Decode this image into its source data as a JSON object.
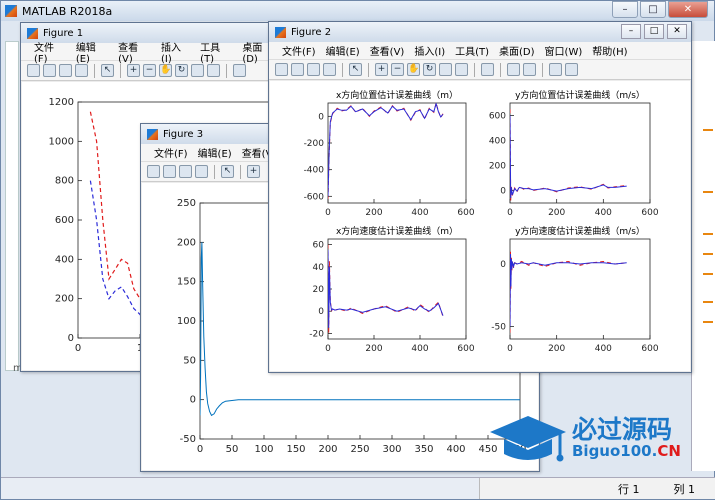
{
  "main_window": {
    "title": "MATLAB R2018a"
  },
  "status": {
    "row_label": "行",
    "row_value": "1",
    "col_label": "列",
    "col_value": "1"
  },
  "left_pane_letter": "m",
  "figure1": {
    "title": "Figure 1",
    "menu": [
      "文件(F)",
      "编辑(E)",
      "查看(V)",
      "插入(I)",
      "工具(T)",
      "桌面(D)"
    ]
  },
  "figure2": {
    "title": "Figure 2",
    "menu": [
      "文件(F)",
      "编辑(E)",
      "查看(V)",
      "插入(I)",
      "工具(T)",
      "桌面(D)",
      "窗口(W)",
      "帮助(H)"
    ]
  },
  "figure3": {
    "title": "Figure 3",
    "menu": [
      "文件(F)",
      "编辑(E)",
      "查看(V)"
    ]
  },
  "watermark": {
    "text_cn": "必过源码",
    "text_en_main": "Biguo100.",
    "text_en_accent": "CN"
  },
  "colors": {
    "blue": "#2b2bd8",
    "red": "#e01b1b",
    "matlab_blue": "#0072bd",
    "accent": "#1d78c8"
  },
  "chart_data": [
    {
      "id": "figure1",
      "type": "line",
      "title": "",
      "xlim": [
        0,
        100
      ],
      "ylim": [
        0,
        1200
      ],
      "yticks": [
        0,
        200,
        400,
        600,
        800,
        1000,
        1200
      ],
      "xticks": [
        0,
        10
      ],
      "xtick_labels": [
        "0",
        "1"
      ],
      "series": [
        {
          "color": "red",
          "style": "dashed",
          "x": [
            2,
            3,
            4,
            5,
            6,
            7,
            8,
            9,
            10,
            11,
            12,
            13,
            14,
            15,
            16,
            18,
            20,
            22,
            24,
            26,
            28,
            30
          ],
          "y": [
            1150,
            1000,
            600,
            300,
            350,
            400,
            380,
            250,
            200,
            130,
            160,
            100,
            150,
            120,
            140,
            100,
            130,
            80,
            120,
            100,
            60,
            40
          ]
        },
        {
          "color": "blue",
          "style": "dashed",
          "x": [
            2,
            3,
            4,
            5,
            6,
            7,
            8,
            9,
            10,
            11,
            12,
            13,
            14,
            15,
            16,
            18,
            20,
            22,
            24,
            26,
            28,
            30
          ],
          "y": [
            800,
            600,
            300,
            200,
            240,
            260,
            210,
            150,
            120,
            60,
            100,
            50,
            110,
            80,
            90,
            60,
            100,
            40,
            80,
            60,
            20,
            10
          ]
        }
      ]
    },
    {
      "id": "figure3",
      "type": "line",
      "xlim": [
        0,
        500
      ],
      "ylim": [
        -50,
        250
      ],
      "yticks": [
        -50,
        0,
        50,
        100,
        150,
        200,
        250
      ],
      "xticks": [
        0,
        50,
        100,
        150,
        200,
        250,
        300,
        350,
        400,
        450,
        500
      ],
      "xtick_labels": [
        "0",
        "50",
        "100",
        "150",
        "200",
        "250",
        "300",
        "350",
        "400",
        "450",
        "50"
      ],
      "series": [
        {
          "color": "matlab_blue",
          "style": "solid",
          "x": [
            0,
            1,
            2,
            3,
            4,
            6,
            8,
            10,
            12,
            15,
            18,
            22,
            26,
            30,
            35,
            40,
            50,
            60,
            80,
            100,
            200,
            300,
            400,
            500
          ],
          "y": [
            -20,
            30,
            180,
            200,
            150,
            80,
            40,
            10,
            -5,
            -15,
            -20,
            -18,
            -12,
            -8,
            -4,
            -2,
            -1,
            0,
            0,
            0,
            0,
            0,
            0,
            0
          ]
        }
      ]
    },
    {
      "id": "figure2_pos_x",
      "type": "line",
      "title": "x方向位置估计误差曲线（m）",
      "xlim": [
        0,
        600
      ],
      "ylim": [
        -650,
        100
      ],
      "yticks": [
        -600,
        -400,
        -200,
        0
      ],
      "xticks": [
        0,
        200,
        400,
        600
      ],
      "series": [
        {
          "color": "red",
          "style": "dashed",
          "x": [
            0,
            5,
            10,
            20,
            40,
            60,
            80,
            100,
            120,
            150,
            180,
            200,
            230,
            260,
            280,
            300,
            330,
            360,
            380,
            400,
            420,
            440,
            460,
            470,
            480,
            490,
            500
          ],
          "y": [
            -620,
            -300,
            -50,
            20,
            60,
            40,
            50,
            80,
            30,
            60,
            0,
            40,
            70,
            20,
            80,
            40,
            60,
            -30,
            30,
            50,
            -20,
            60,
            30,
            100,
            40,
            -10,
            20
          ]
        },
        {
          "color": "blue",
          "style": "solid",
          "x": [
            0,
            5,
            10,
            20,
            40,
            60,
            80,
            100,
            120,
            150,
            180,
            200,
            230,
            260,
            280,
            300,
            330,
            360,
            380,
            400,
            420,
            440,
            460,
            470,
            480,
            490,
            500
          ],
          "y": [
            -600,
            -280,
            -40,
            25,
            55,
            45,
            45,
            75,
            35,
            55,
            5,
            35,
            65,
            25,
            75,
            45,
            55,
            -25,
            35,
            45,
            -15,
            55,
            35,
            95,
            35,
            -5,
            15
          ]
        }
      ]
    },
    {
      "id": "figure2_pos_y",
      "type": "line",
      "title": "y方向位置估计误差曲线（m/s）",
      "xlim": [
        0,
        600
      ],
      "ylim": [
        -100,
        700
      ],
      "yticks": [
        0,
        200,
        400,
        600
      ],
      "xticks": [
        0,
        200,
        400,
        600
      ],
      "series": [
        {
          "color": "red",
          "style": "dashed",
          "x": [
            0,
            3,
            6,
            10,
            20,
            30,
            40,
            60,
            80,
            100,
            150,
            200,
            250,
            300,
            350,
            400,
            420,
            450,
            500
          ],
          "y": [
            650,
            -80,
            30,
            -40,
            20,
            -10,
            30,
            10,
            20,
            0,
            20,
            -10,
            20,
            30,
            10,
            50,
            20,
            30,
            40
          ]
        },
        {
          "color": "blue",
          "style": "solid",
          "x": [
            0,
            3,
            6,
            10,
            20,
            30,
            40,
            60,
            80,
            100,
            150,
            200,
            250,
            300,
            350,
            400,
            420,
            450,
            500
          ],
          "y": [
            600,
            -60,
            25,
            -35,
            15,
            -5,
            25,
            15,
            15,
            5,
            15,
            -5,
            15,
            25,
            15,
            45,
            25,
            25,
            35
          ]
        }
      ]
    },
    {
      "id": "figure2_vel_x",
      "type": "line",
      "title": "x方向速度估计误差曲线（m）",
      "xlim": [
        0,
        600
      ],
      "ylim": [
        -25,
        65
      ],
      "yticks": [
        -20,
        0,
        20,
        40,
        60
      ],
      "xticks": [
        0,
        200,
        400,
        600
      ],
      "series": [
        {
          "color": "red",
          "style": "dashed",
          "x": [
            0,
            3,
            6,
            10,
            15,
            20,
            30,
            50,
            80,
            100,
            150,
            200,
            250,
            300,
            350,
            380,
            400,
            420,
            440,
            460,
            480,
            500
          ],
          "y": [
            60,
            -20,
            45,
            10,
            0,
            3,
            1,
            2,
            0,
            3,
            -2,
            2,
            5,
            -1,
            4,
            0,
            6,
            3,
            -1,
            4,
            8,
            -5
          ]
        },
        {
          "color": "blue",
          "style": "solid",
          "x": [
            0,
            3,
            6,
            10,
            15,
            20,
            30,
            50,
            80,
            100,
            150,
            200,
            250,
            300,
            350,
            380,
            400,
            420,
            440,
            460,
            480,
            500
          ],
          "y": [
            55,
            -15,
            40,
            8,
            1,
            2,
            1,
            2,
            1,
            2,
            -1,
            2,
            4,
            0,
            3,
            1,
            5,
            2,
            0,
            3,
            7,
            -4
          ]
        }
      ]
    },
    {
      "id": "figure2_vel_y",
      "type": "line",
      "title": "y方向速度估计误差曲线（m/s）",
      "xlim": [
        0,
        600
      ],
      "ylim": [
        -60,
        20
      ],
      "yticks": [
        -50,
        0
      ],
      "xticks": [
        0,
        200,
        400,
        600
      ],
      "series": [
        {
          "color": "red",
          "style": "dashed",
          "x": [
            0,
            2,
            4,
            6,
            8,
            10,
            15,
            20,
            30,
            50,
            80,
            100,
            150,
            200,
            250,
            300,
            350,
            400,
            450,
            500
          ],
          "y": [
            -55,
            10,
            -20,
            5,
            -5,
            2,
            -3,
            1,
            0,
            2,
            -1,
            1,
            -2,
            1,
            2,
            -1,
            1,
            2,
            0,
            1
          ]
        },
        {
          "color": "blue",
          "style": "solid",
          "x": [
            0,
            2,
            4,
            6,
            8,
            10,
            15,
            20,
            30,
            50,
            80,
            100,
            150,
            200,
            250,
            300,
            350,
            400,
            450,
            500
          ],
          "y": [
            -50,
            8,
            -18,
            4,
            -4,
            2,
            -2,
            1,
            0,
            1,
            0,
            1,
            -1,
            1,
            1,
            0,
            1,
            1,
            0,
            1
          ]
        }
      ]
    }
  ]
}
